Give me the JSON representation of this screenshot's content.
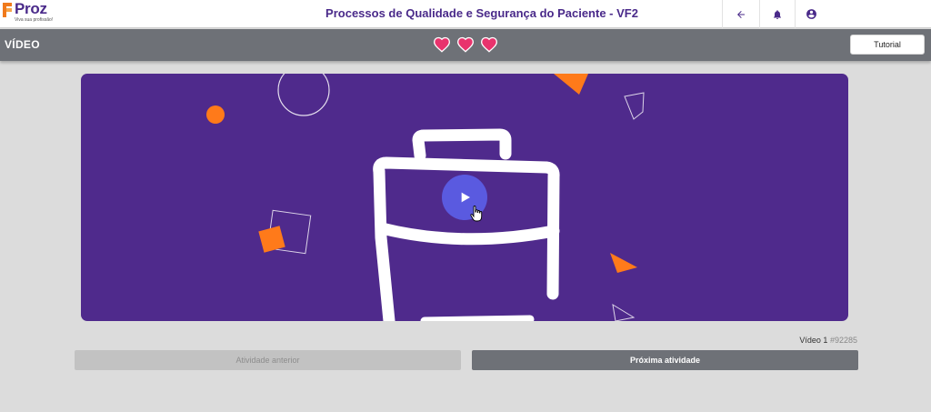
{
  "header": {
    "logo": {
      "name": "Proz",
      "tagline": "Viva sua profissão!"
    },
    "title": "Processos de Qualidade e Segurança do Paciente - VF2",
    "icons": [
      "back-arrow-icon",
      "bell-icon",
      "account-circle-icon"
    ]
  },
  "section": {
    "title": "VÍDEO",
    "lives": 3,
    "tutorial_label": "Tutorial"
  },
  "video": {
    "label": "Vídeo",
    "number": "1",
    "id": "#92285"
  },
  "navigation": {
    "prev_label": "Atividade anterior",
    "next_label": "Próxima atividade"
  },
  "colors": {
    "brand_purple": "#4a2a8a",
    "video_bg": "#4f2a8c",
    "accent_orange": "#ff7a1a",
    "play_button": "#5a5ae0",
    "heart": "#e8336d",
    "bar_gray": "#6e7177"
  }
}
